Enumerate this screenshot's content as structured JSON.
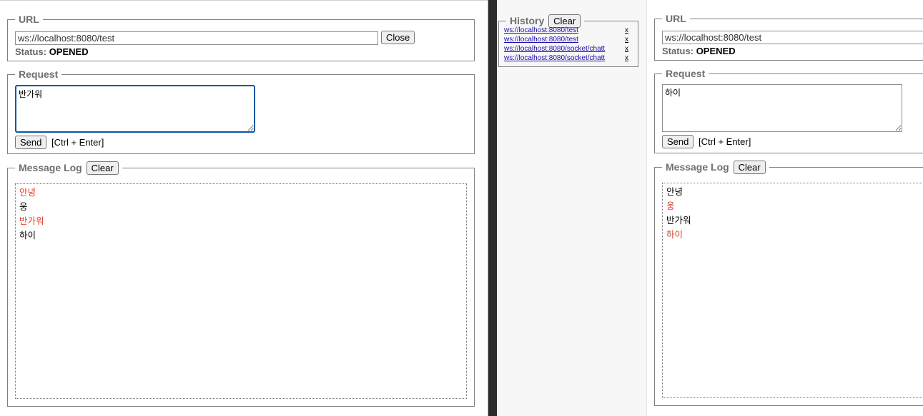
{
  "left": {
    "url_legend": "URL",
    "url_value": "ws://localhost:8080/test",
    "close_label": "Close",
    "status_key": "Status:",
    "status_value": "OPENED",
    "request_legend": "Request",
    "request_text": "반가워",
    "send_label": "Send",
    "send_hint": "[Ctrl + Enter]",
    "log_legend": "Message Log",
    "log_clear_label": "Clear",
    "messages": [
      {
        "text": "안녕",
        "kind": "sent"
      },
      {
        "text": "웅",
        "kind": "received"
      },
      {
        "text": "반가워",
        "kind": "sent"
      },
      {
        "text": "하이",
        "kind": "received"
      }
    ]
  },
  "history": {
    "legend": "History",
    "clear_label": "Clear",
    "items": [
      {
        "url": "ws://localhost:8080/test",
        "remove": "x"
      },
      {
        "url": "ws://localhost:8080/test",
        "remove": "x"
      },
      {
        "url": "ws://localhost:8080/socket/chatt",
        "remove": "x"
      },
      {
        "url": "ws://localhost:8080/socket/chatt",
        "remove": "x"
      }
    ]
  },
  "right": {
    "url_legend": "URL",
    "url_value": "ws://localhost:8080/test",
    "status_key": "Status:",
    "status_value": "OPENED",
    "request_legend": "Request",
    "request_text": "하이",
    "send_label": "Send",
    "send_hint": "[Ctrl + Enter]",
    "log_legend": "Message Log",
    "log_clear_label": "Clear",
    "messages": [
      {
        "text": "안녕",
        "kind": "received"
      },
      {
        "text": "웅",
        "kind": "sent"
      },
      {
        "text": "반가워",
        "kind": "received"
      },
      {
        "text": "하이",
        "kind": "sent"
      }
    ]
  },
  "colors": {
    "sent": "#e0402a",
    "received": "#000000",
    "focus_border": "#0b57a6",
    "divider": "#2b2b2b"
  }
}
